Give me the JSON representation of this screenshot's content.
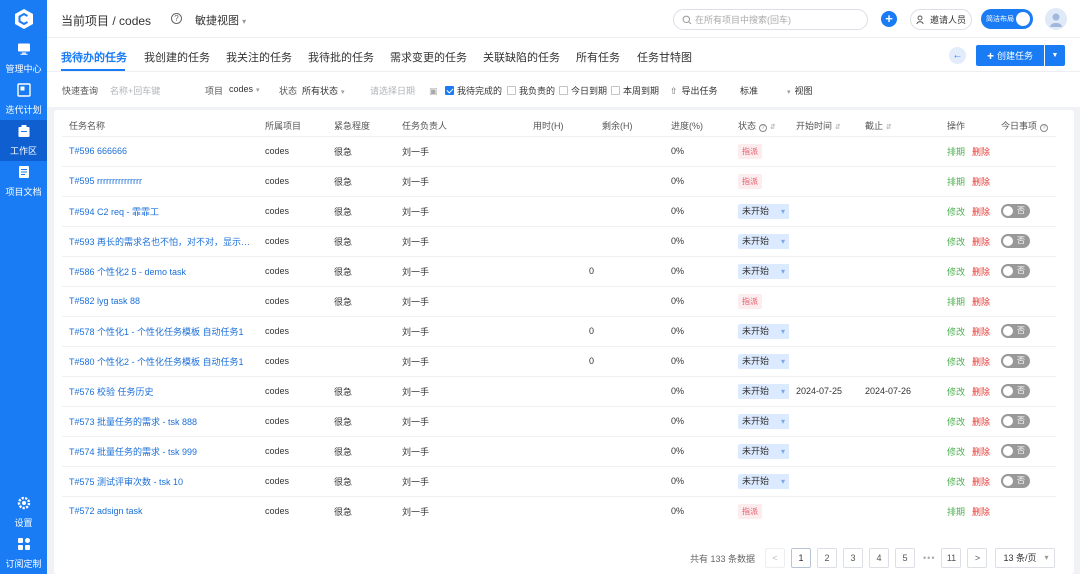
{
  "sidebar": {
    "items": [
      {
        "label": "管理中心",
        "icon": "monitor-icon"
      },
      {
        "label": "迭代计划",
        "icon": "iteration-icon"
      },
      {
        "label": "工作区",
        "icon": "workspace-icon"
      },
      {
        "label": "项目文档",
        "icon": "document-icon"
      }
    ],
    "bottom": [
      {
        "label": "设置",
        "icon": "gear-icon"
      },
      {
        "label": "订阅定制",
        "icon": "grid-icon"
      }
    ]
  },
  "header": {
    "project_prefix": "当前项目 /",
    "project_name": "codes",
    "view_label": "敏捷视图",
    "search_placeholder": "在所有项目中搜索(回车)",
    "invite_label": "邀请人员",
    "layout_toggle_label": "简洁布局"
  },
  "tabs": [
    {
      "label": "我待办的任务"
    },
    {
      "label": "我创建的任务"
    },
    {
      "label": "我关注的任务"
    },
    {
      "label": "我待批的任务"
    },
    {
      "label": "需求变更的任务"
    },
    {
      "label": "关联缺陷的任务"
    },
    {
      "label": "所有任务"
    },
    {
      "label": "任务甘特图"
    }
  ],
  "actions": {
    "back": "←",
    "create_label": "创建任务"
  },
  "filters": {
    "quick_label": "快速查询",
    "quick_placeholder": "名称+回车键",
    "project_label": "项目",
    "project_value": "codes",
    "status_label": "状态",
    "status_value": "所有状态",
    "date_placeholder": "请选择日期",
    "chk_pending_done": "我待完成的",
    "chk_mine": "我负责的",
    "chk_today": "今日到期",
    "chk_week": "本周到期",
    "export_label": "导出任务",
    "standard_label": "标准",
    "view_label": "视图"
  },
  "table": {
    "headers": {
      "name": "任务名称",
      "project": "所属项目",
      "urgency": "紧急程度",
      "owner": "任务负责人",
      "used": "用时(H)",
      "remain": "剩余(H)",
      "progress": "进度(%)",
      "status": "状态",
      "start": "开始时间",
      "due": "截止",
      "ops": "操作",
      "today": "今日事项"
    },
    "rows": [
      {
        "name": "T#596 666666",
        "project": "codes",
        "urgency": "很急",
        "owner": "刘一手",
        "used": "",
        "remain": "",
        "progress": "0%",
        "status": "指派",
        "start": "",
        "due": "",
        "op1": "排期",
        "op2": "删除",
        "today": ""
      },
      {
        "name": "T#595 rrrrrrrrrrrrrrr",
        "project": "codes",
        "urgency": "很急",
        "owner": "刘一手",
        "used": "",
        "remain": "",
        "progress": "0%",
        "status": "指派",
        "start": "",
        "due": "",
        "op1": "排期",
        "op2": "删除",
        "today": ""
      },
      {
        "name": "T#594 C2 req - 霏霏工",
        "project": "codes",
        "urgency": "很急",
        "owner": "刘一手",
        "used": "",
        "remain": "",
        "progress": "0%",
        "status": "未开始",
        "start": "",
        "due": "",
        "op1": "修改",
        "op2": "删除",
        "today": "否"
      },
      {
        "name": "T#593 再长的需求名也不怕，对不对，显示完整",
        "project": "codes",
        "urgency": "很急",
        "owner": "刘一手",
        "used": "",
        "remain": "",
        "progress": "0%",
        "status": "未开始",
        "start": "",
        "due": "",
        "op1": "修改",
        "op2": "删除",
        "today": "否"
      },
      {
        "name": "T#586 个性化2 5 - demo task",
        "project": "codes",
        "urgency": "很急",
        "owner": "刘一手",
        "used": "0",
        "remain": "",
        "progress": "0%",
        "status": "未开始",
        "start": "",
        "due": "",
        "op1": "修改",
        "op2": "删除",
        "today": "否"
      },
      {
        "name": "T#582 lyg task 88",
        "project": "codes",
        "urgency": "很急",
        "owner": "刘一手",
        "used": "",
        "remain": "",
        "progress": "0%",
        "status": "指派",
        "start": "",
        "due": "",
        "op1": "排期",
        "op2": "删除",
        "today": ""
      },
      {
        "name": "T#578 个性化1 - 个性化任务模板 自动任务1",
        "project": "codes",
        "urgency": "",
        "owner": "刘一手",
        "used": "0",
        "remain": "",
        "progress": "0%",
        "status": "未开始",
        "start": "",
        "due": "",
        "op1": "修改",
        "op2": "删除",
        "today": "否"
      },
      {
        "name": "T#580 个性化2 - 个性化任务模板 自动任务1",
        "project": "codes",
        "urgency": "",
        "owner": "刘一手",
        "used": "0",
        "remain": "",
        "progress": "0%",
        "status": "未开始",
        "start": "",
        "due": "",
        "op1": "修改",
        "op2": "删除",
        "today": "否"
      },
      {
        "name": "T#576 校验 任务历史",
        "project": "codes",
        "urgency": "很急",
        "owner": "刘一手",
        "used": "",
        "remain": "",
        "progress": "0%",
        "status": "未开始",
        "start": "2024-07-25",
        "due": "2024-07-26",
        "op1": "修改",
        "op2": "删除",
        "today": "否"
      },
      {
        "name": "T#573 批量任务的需求 - tsk 888",
        "project": "codes",
        "urgency": "很急",
        "owner": "刘一手",
        "used": "",
        "remain": "",
        "progress": "0%",
        "status": "未开始",
        "start": "",
        "due": "",
        "op1": "修改",
        "op2": "删除",
        "today": "否"
      },
      {
        "name": "T#574 批量任务的需求 - tsk 999",
        "project": "codes",
        "urgency": "很急",
        "owner": "刘一手",
        "used": "",
        "remain": "",
        "progress": "0%",
        "status": "未开始",
        "start": "",
        "due": "",
        "op1": "修改",
        "op2": "删除",
        "today": "否"
      },
      {
        "name": "T#575 测试评审次数 - tsk 10",
        "project": "codes",
        "urgency": "很急",
        "owner": "刘一手",
        "used": "",
        "remain": "",
        "progress": "0%",
        "status": "未开始",
        "start": "",
        "due": "",
        "op1": "修改",
        "op2": "删除",
        "today": "否"
      },
      {
        "name": "T#572 adsign task",
        "project": "codes",
        "urgency": "很急",
        "owner": "刘一手",
        "used": "",
        "remain": "",
        "progress": "0%",
        "status": "指派",
        "start": "",
        "due": "",
        "op1": "排期",
        "op2": "删除",
        "today": ""
      }
    ]
  },
  "pagination": {
    "total_text": "共有 133 条数据",
    "prev": "<",
    "pages": [
      "1",
      "2",
      "3",
      "4",
      "5"
    ],
    "ellipsis": "•••",
    "last": "11",
    "next": ">",
    "page_size": "13 条/页"
  },
  "colors": {
    "brand": "#1a7cf5",
    "link": "#1a6fd8",
    "edit": "#4caf50",
    "delete": "#e53935"
  }
}
